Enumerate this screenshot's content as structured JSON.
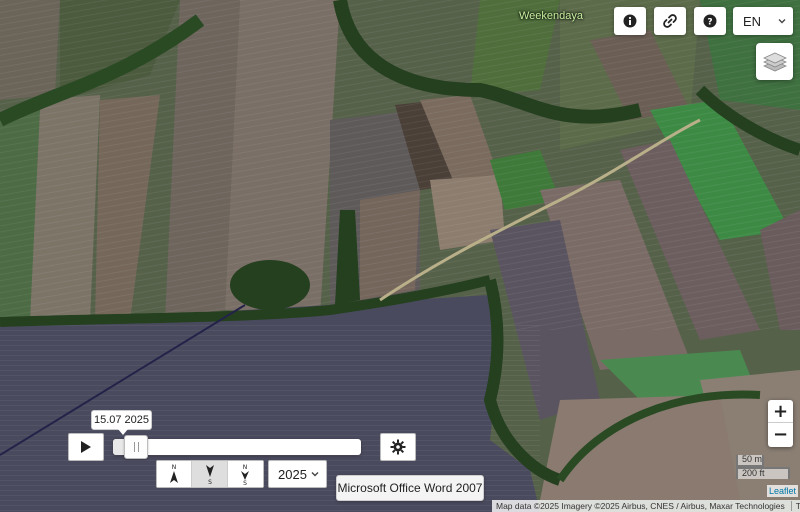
{
  "map": {
    "place_label": "Weekendaya"
  },
  "toolbar": {
    "info_icon": "info-circle-icon",
    "link_icon": "link-icon",
    "help_icon": "question-circle-icon",
    "language": "EN",
    "layers_icon": "layers-icon"
  },
  "timeline": {
    "date_label": "15.07 2025",
    "progress": 0.05,
    "year": "2025",
    "orientation": [
      {
        "top": "N",
        "bottom": "",
        "active": false
      },
      {
        "top": "",
        "bottom": "S",
        "active": true
      },
      {
        "top": "N",
        "bottom": "S",
        "active": false
      }
    ],
    "tooltip": "Microsoft Office Word 2007"
  },
  "zoom": {
    "in_label": "+",
    "out_label": "−"
  },
  "scale": {
    "metric": "50 m",
    "imperial": "200 ft"
  },
  "attribution": {
    "leaflet": "Leaflet",
    "text": "Map data ©2025 Imagery ©2025 Airbus, CNES / Airbus, Maxar Technologies",
    "terms": "Terms"
  },
  "colors": {
    "field_dark": "#4a4a5e",
    "field_green": "#3f6e3a",
    "tree": "#24401f",
    "road": "#b9b08a"
  }
}
